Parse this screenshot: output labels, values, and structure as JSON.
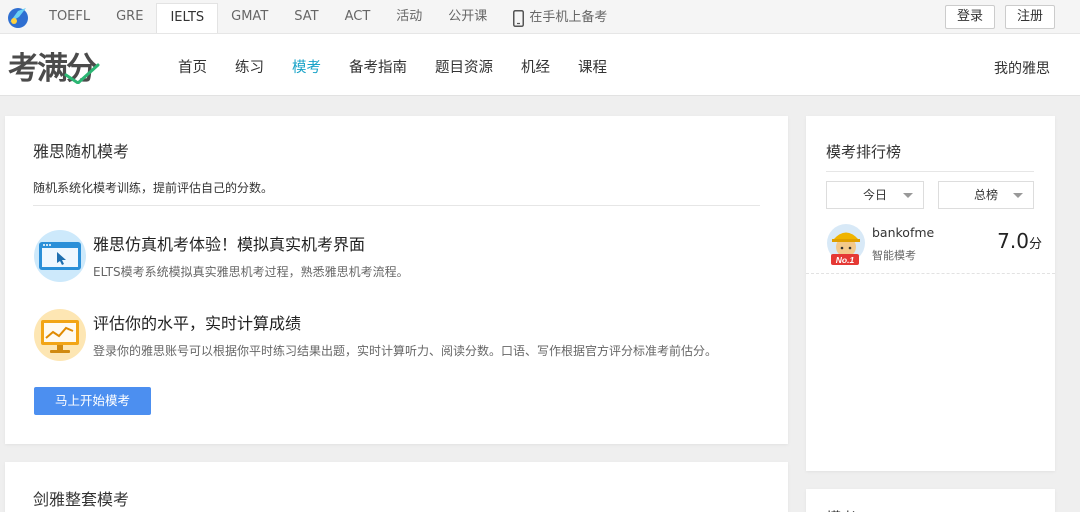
{
  "topbar": {
    "tabs": [
      "TOEFL",
      "GRE",
      "IELTS",
      "GMAT",
      "SAT",
      "ACT",
      "活动",
      "公开课"
    ],
    "active_tab": "IELTS",
    "mobile_link": "在手机上备考",
    "login": "登录",
    "register": "注册"
  },
  "nav": {
    "brand": "考满分",
    "items": [
      "首页",
      "练习",
      "模考",
      "备考指南",
      "题目资源",
      "机经",
      "课程"
    ],
    "active": "模考",
    "right": "我的雅思"
  },
  "main": {
    "title": "雅思随机模考",
    "description": "随机系统化模考训练，提前评估自己的分数。",
    "features": [
      {
        "title": "雅思仿真机考体验！模拟真实机考界面",
        "desc": "ELTS模考系统模拟真实雅思机考过程，熟悉雅思机考流程。",
        "icon": "computer-screen-icon"
      },
      {
        "title": "评估你的水平，实时计算成绩",
        "desc": "登录你的雅思账号可以根据你平时练习结果出题，实时计算听力、阅读分数。口语、写作根据官方评分标准考前估分。",
        "icon": "chart-monitor-icon"
      }
    ],
    "start_button": "马上开始模考"
  },
  "second": {
    "title": "剑雅整套模考"
  },
  "ranking": {
    "title": "模考排行榜",
    "select_period": "今日",
    "select_scope": "总榜",
    "entries": [
      {
        "name": "bankofme",
        "subtitle": "智能模考",
        "score": "7.0",
        "unit": "分",
        "badge": "No.1"
      }
    ]
  },
  "side2": {
    "title": "模考"
  },
  "colors": {
    "accent": "#1aa3c8",
    "button": "#4c8ff0"
  }
}
